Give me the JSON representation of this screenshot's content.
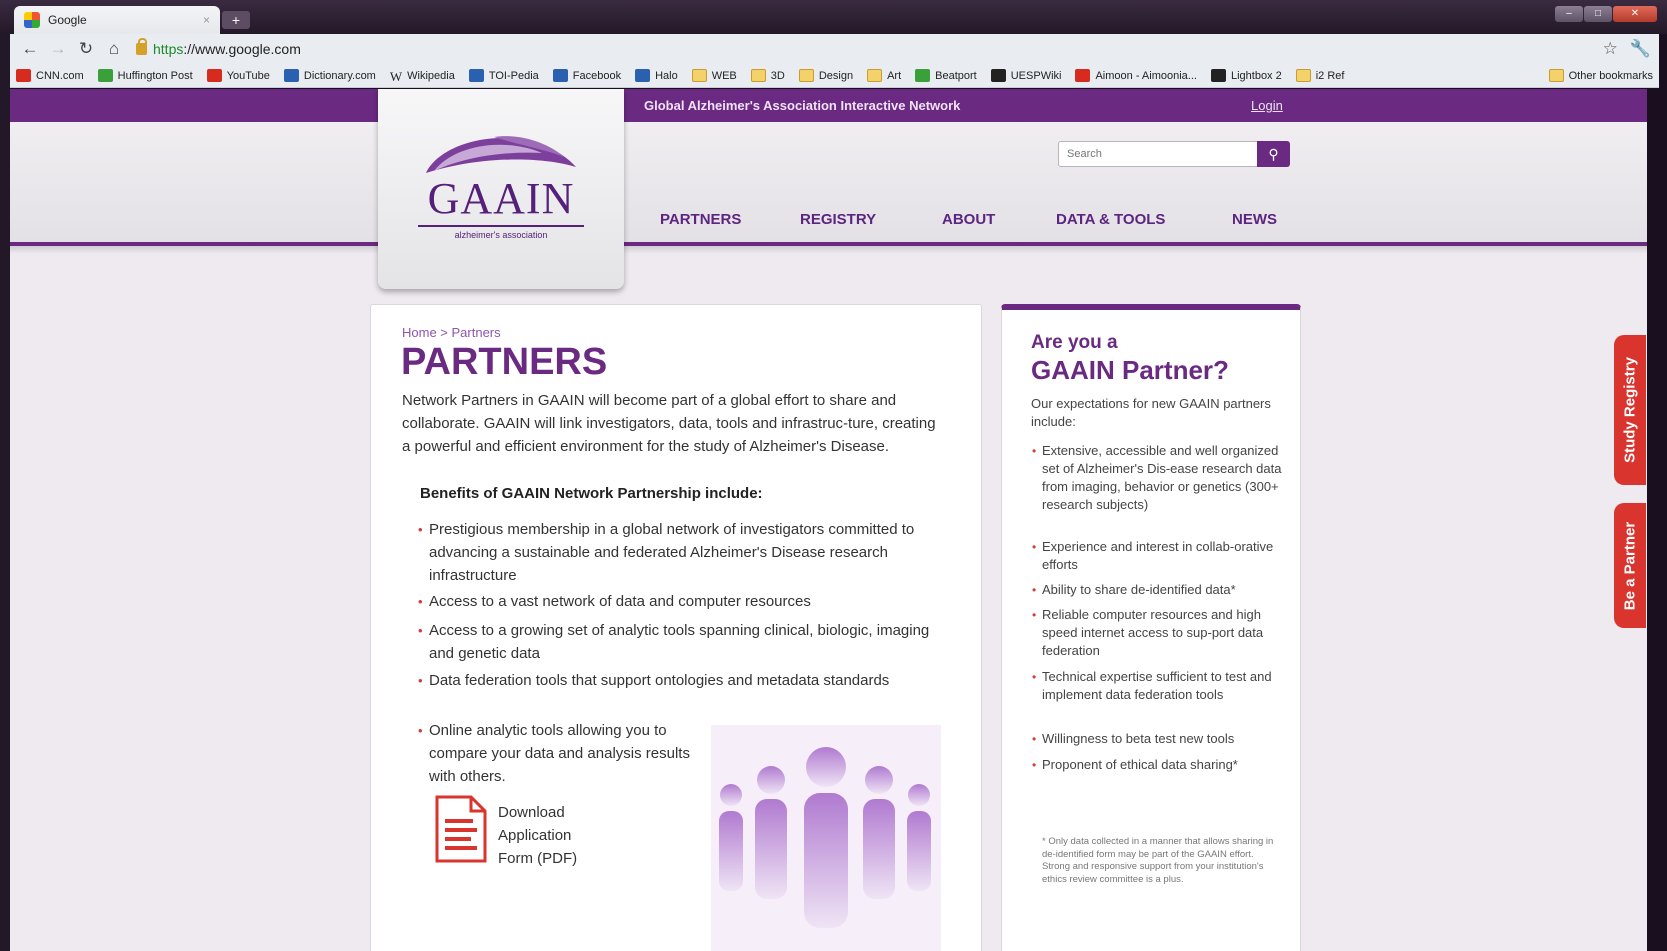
{
  "browser": {
    "tab_title": "Google",
    "url_https": "https",
    "url_rest": "://www.google.com",
    "bookmarks": [
      "CNN.com",
      "Huffington Post",
      "YouTube",
      "Dictionary.com",
      "Wikipedia",
      "TOI-Pedia",
      "Facebook",
      "Halo",
      "WEB",
      "3D",
      "Design",
      "Art",
      "Beatport",
      "UESPWiki",
      "Aimoon - Aimoonia...",
      "Lightbox 2",
      "i2 Ref"
    ],
    "other_bookmarks": "Other bookmarks"
  },
  "site": {
    "top_title": "Global Alzheimer's Association Interactive Network",
    "login": "Login",
    "logo_text": "GAAIN",
    "logo_sub": "alzheimer's association",
    "search_placeholder": "Search",
    "nav": [
      "PARTNERS",
      "REGISTRY",
      "ABOUT",
      "DATA & TOOLS",
      "NEWS"
    ]
  },
  "main": {
    "breadcrumb": "Home > Partners",
    "title": "PARTNERS",
    "intro": "Network Partners in GAAIN will become part of a global effort to share and collaborate. GAAIN will link investigators, data, tools and infrastruc-ture, creating a powerful and efficient environment for the study of Alzheimer's Disease.",
    "benefits_heading": "Benefits of GAAIN Network Partnership include:",
    "benefits": [
      "Prestigious membership in a global network of investigators committed to advancing a sustainable and federated Alzheimer's Disease research infrastructure",
      "Access to a vast network of data and computer resources",
      "Access to a growing set of analytic tools spanning clinical, biologic, imaging and genetic data",
      "Data federation tools that support ontologies and metadata standards",
      "Online analytic tools allowing you to compare your data and analysis results with others."
    ],
    "download": "Download Application Form (PDF)"
  },
  "side": {
    "heading_small": "Are you a",
    "heading_big": "GAAIN Partner?",
    "intro": "Our expectations for new GAAIN partners include:",
    "items": [
      "Extensive, accessible and well organized set of Alzheimer's Dis-ease research data from imaging, behavior or genetics (300+ research subjects)",
      "Experience and interest in collab-orative efforts",
      "Ability to share de-identified data*",
      "Reliable computer resources and high speed internet access to sup-port data federation",
      "Technical expertise sufficient to test and implement data federation tools",
      "Willingness to beta test new tools",
      "Proponent of ethical data sharing*"
    ],
    "footnote": "* Only data collected in a manner that allows sharing in de-identified form may be part of the GAAIN effort. Strong and responsive support from your institution's ethics review committee is a plus."
  },
  "side_tabs": {
    "study_registry": "Study Registry",
    "be_a_partner": "Be a Partner"
  },
  "colors": {
    "brand_purple": "#6a2a82",
    "accent_red": "#d9342d"
  }
}
